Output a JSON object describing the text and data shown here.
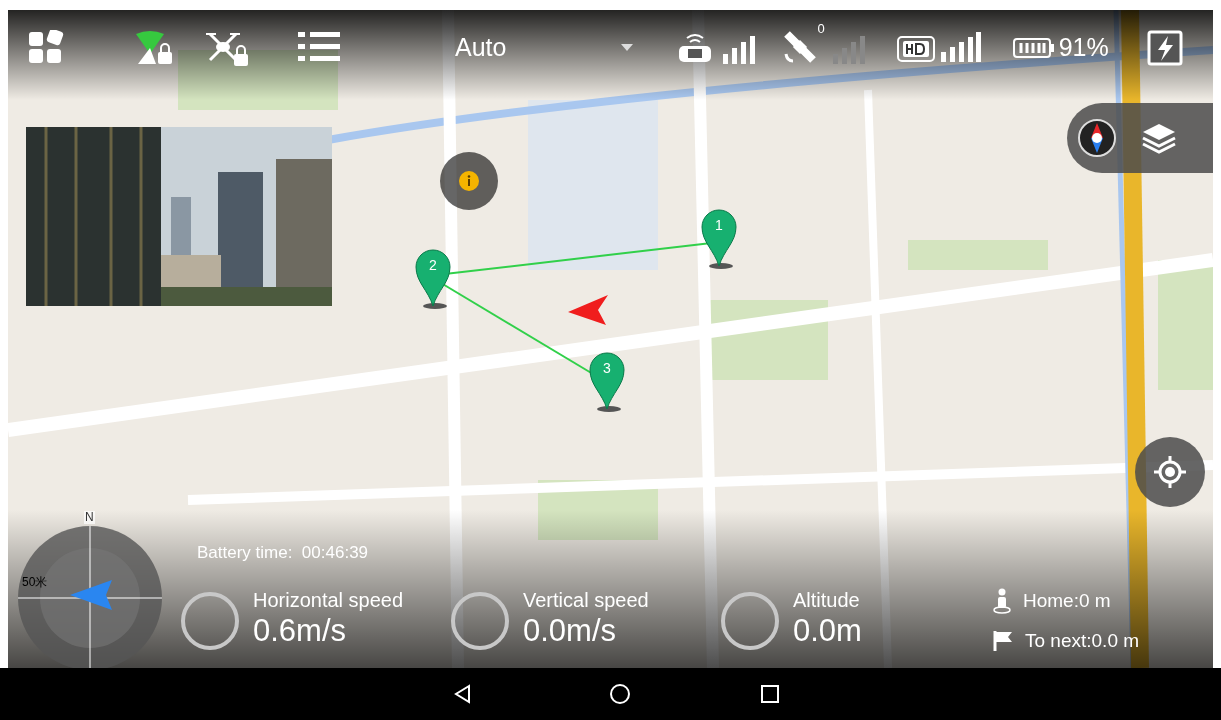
{
  "top_bar": {
    "flight_mode": "Auto",
    "satellite_count": "0",
    "battery": "91%"
  },
  "waypoints": [
    {
      "label": "1"
    },
    {
      "label": "2"
    },
    {
      "label": "3"
    }
  ],
  "compass": {
    "north": "N",
    "scale": "50米"
  },
  "telemetry": {
    "battery_time": "Battery time:  00:46:39",
    "gauges": [
      {
        "label": "Horizontal speed",
        "value": "0.6m/s"
      },
      {
        "label": "Vertical speed",
        "value": "0.0m/s"
      },
      {
        "label": "Altitude",
        "value": "0.0m"
      }
    ],
    "distances": [
      {
        "kind": "home",
        "text": "Home:0 m"
      },
      {
        "kind": "next",
        "text": "To next:0.0 m"
      }
    ]
  }
}
